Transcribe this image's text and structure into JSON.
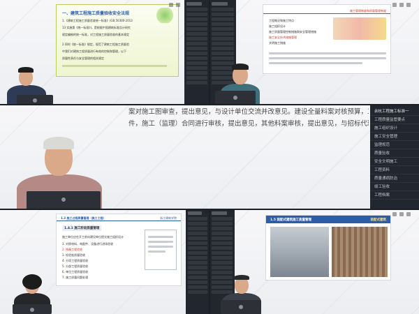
{
  "top_left": {
    "slide_title": "一、建筑工程施工质量验收安全法规",
    "slide_lines": [
      "1.《建筑工程施工质量验收统一标准》(GB 50300-2013",
      "13 实施第《统一标准》)，是根据中国建筑标准设计研究",
      "规定编制的统一标准，对工程施工质量验收的基本规定",
      "2.同时《统一标准》规定，规范了建筑工程施工质量验",
      "中我们对建筑工程质量进行有效的控制和管理，以下",
      "质量性责任与安全管理的相关规定"
    ]
  },
  "top_right": {
    "slide_header": "施工管理制度和质量管理制度",
    "slide_bullets": [
      "工程概况和施工特点",
      "施工组织设计",
      "施工质量管理控制措施和安全管理措施",
      "施工安全技术措施管理",
      "文明施工措施"
    ]
  },
  "middle": {
    "caption_lines": [
      "案对施工图审查，提出意见，与设计单位交流并改意见。建设全量料案对核预算，工程量清单，招标文",
      "件，施工（监理）合同进行审核，提出意见，其他料案审核，提出意见，与招标代理机构交换意见。"
    ]
  },
  "middle_sidebar": {
    "items": [
      "余杭工程施工标准一",
      "工程质量监管要点",
      "施工组织设计",
      "施工安全管理",
      "监理规范",
      "质量验收",
      "安全文明施工",
      "工程资料",
      "质量通病防治",
      "竣工验收",
      "工程档案",
      "现场管理"
    ]
  },
  "bottom_left": {
    "slide_section": "1.3 施工过程质量管理（施工工程）",
    "slide_subtitle": "1.4.1 施工阶段质量管理",
    "logo_text": "浙江建筑学院",
    "slide_lines": [
      "施工单位应在开工前向建设单位提交施工组织设计",
      "1. 对原材料、构配件、设备进行进场验收",
      "2. 隐蔽工程验收",
      "3. 检验批质量验收",
      "4. 分项工程质量验收",
      "5. 分部工程质量验收",
      "6. 单位工程质量验收",
      "7. 施工质量问题处理"
    ]
  },
  "bottom_right": {
    "slide_title": "1.5 装配式建筑施工质量管理",
    "slide_tag": "装配式建筑"
  },
  "colors": {
    "accent_red": "#c0392b",
    "slide_blue": "#2e5da8",
    "dark_panel": "#22262e"
  }
}
